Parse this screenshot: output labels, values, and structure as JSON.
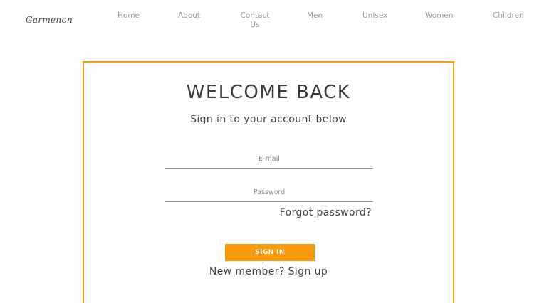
{
  "navbar": {
    "brand": "Garmenon",
    "links": [
      {
        "label": "Home"
      },
      {
        "label": "About"
      },
      {
        "label": "Contact Us"
      },
      {
        "label": "Men"
      },
      {
        "label": "Unisex"
      },
      {
        "label": "Women"
      },
      {
        "label": "Children"
      }
    ]
  },
  "login": {
    "title": "WELCOME BACK",
    "subtitle": "Sign in to your account below",
    "email_placeholder": "E-mail",
    "password_placeholder": "Password",
    "forgot_label": "Forgot password?",
    "signin_label": "SIGN IN",
    "signup_prompt": "New member?",
    "signup_label": "Sign up"
  },
  "colors": {
    "accent": "#f79a0c",
    "card_border": "#f5a01a",
    "nav_text": "#9a9a9a",
    "body_text": "#444444"
  }
}
